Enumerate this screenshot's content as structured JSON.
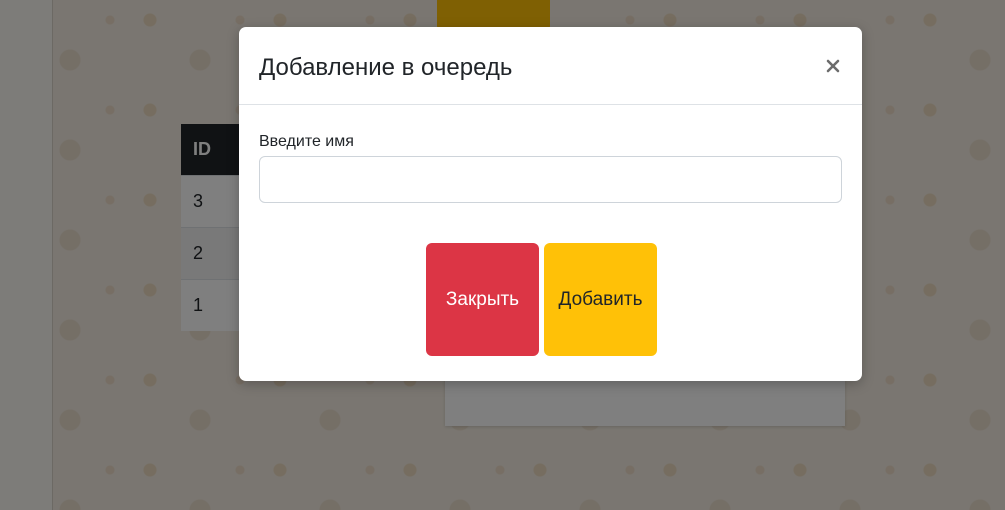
{
  "background_table": {
    "header": "ID",
    "rows": [
      "3",
      "2",
      "1"
    ]
  },
  "modal": {
    "title": "Добавление в очередь",
    "close_icon": "close-icon",
    "field_label": "Введите имя",
    "input_value": "",
    "input_placeholder": "",
    "close_button_label": "Закрыть",
    "add_button_label": "Добавить"
  },
  "colors": {
    "accent_yellow": "#ffc107",
    "danger_red": "#dc3545",
    "table_header": "#212529"
  }
}
